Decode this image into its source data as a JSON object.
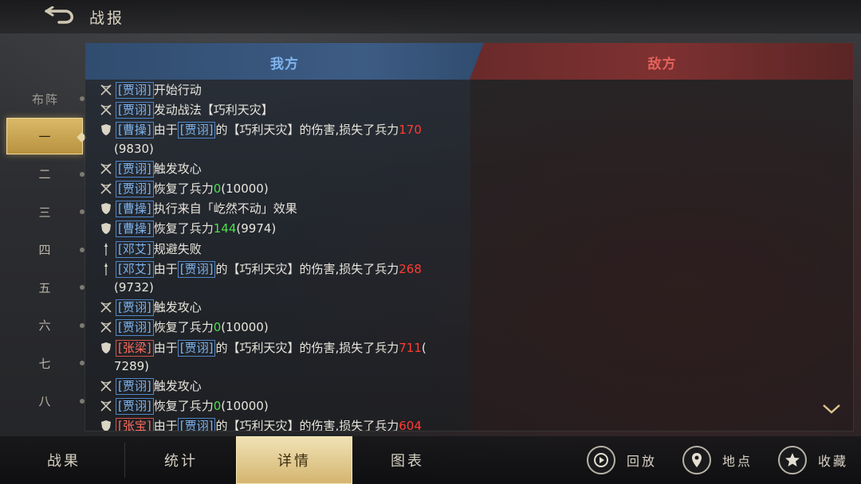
{
  "header": {
    "title": "战报"
  },
  "formation": {
    "label": "布阵",
    "items": [
      {
        "label": "一",
        "active": true
      },
      {
        "label": "二"
      },
      {
        "label": "三"
      },
      {
        "label": "四"
      },
      {
        "label": "五"
      },
      {
        "label": "六"
      },
      {
        "label": "七"
      },
      {
        "label": "八"
      }
    ]
  },
  "tabs": {
    "our": "我方",
    "enemy": "敌方"
  },
  "log": [
    {
      "icon": "bow-icon",
      "parts": [
        "[贾诩]",
        "开始行动"
      ]
    },
    {
      "icon": "bow-icon",
      "parts": [
        "[贾诩]",
        "发动战法【巧利天灾】"
      ]
    },
    {
      "icon": "shield-icon",
      "parts": [
        "[曹操]",
        "由于",
        "[贾诩]",
        "的【巧利天灾】的伤害,损失了兵力",
        "170"
      ],
      "cont": "(9830)"
    },
    {
      "icon": "bow-icon",
      "parts": [
        "[贾诩]",
        "触发攻心"
      ]
    },
    {
      "icon": "bow-icon",
      "parts": [
        "[贾诩]",
        "恢复了兵力",
        "0",
        "(10000)"
      ]
    },
    {
      "icon": "shield-icon",
      "parts": [
        "[曹操]",
        "执行来自「屹然不动」效果"
      ]
    },
    {
      "icon": "shield-icon",
      "parts": [
        "[曹操]",
        "恢复了兵力",
        "144",
        "(9974)"
      ]
    },
    {
      "icon": "spear-icon",
      "parts": [
        "[邓艾]",
        "规避失败"
      ]
    },
    {
      "icon": "spear-icon",
      "parts": [
        "[邓艾]",
        "由于",
        "[贾诩]",
        "的【巧利天灾】的伤害,损失了兵力",
        "268"
      ],
      "cont": "(9732)"
    },
    {
      "icon": "bow-icon",
      "parts": [
        "[贾诩]",
        "触发攻心"
      ]
    },
    {
      "icon": "bow-icon",
      "parts": [
        "[贾诩]",
        "恢复了兵力",
        "0",
        "(10000)"
      ]
    },
    {
      "icon": "shield-icon",
      "parts": [
        "[张梁]",
        "由于",
        "[贾诩]",
        "的【巧利天灾】的伤害,损失了兵力",
        "711",
        "("
      ],
      "cont": "7289)"
    },
    {
      "icon": "bow-icon",
      "parts": [
        "[贾诩]",
        "触发攻心"
      ]
    },
    {
      "icon": "bow-icon",
      "parts": [
        "[贾诩]",
        "恢复了兵力",
        "0",
        "(10000)"
      ]
    },
    {
      "icon": "shield-icon",
      "parts": [
        "[张宝]",
        "由于",
        "[贾诩]",
        "的【巧利天灾】的伤害,损失了兵力",
        "604"
      ]
    }
  ],
  "bottom_tabs": [
    {
      "label": "战果"
    },
    {
      "label": "统计"
    },
    {
      "label": "详情",
      "active": true
    },
    {
      "label": "图表"
    }
  ],
  "actions": {
    "replay": "回放",
    "location": "地点",
    "favorite": "收藏"
  },
  "colors": {
    "accent_gold": "#d9b968",
    "our_blue": "#7fb4ef",
    "enemy_red": "#e5615b",
    "damage_red": "#ff3b32",
    "heal_green": "#4ae04a"
  }
}
